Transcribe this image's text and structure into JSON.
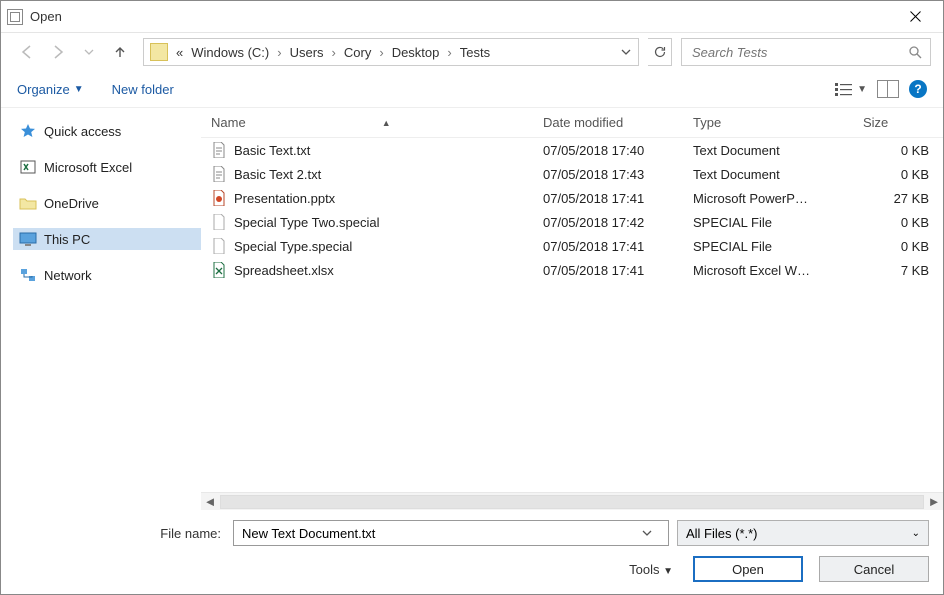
{
  "window": {
    "title": "Open"
  },
  "nav": {
    "breadcrumb_root": "«",
    "segments": [
      "Windows (C:)",
      "Users",
      "Cory",
      "Desktop",
      "Tests"
    ],
    "search_placeholder": "Search Tests"
  },
  "toolbar": {
    "organize": "Organize",
    "new_folder": "New folder"
  },
  "sidebar": {
    "items": [
      {
        "label": "Quick access",
        "icon": "star"
      },
      {
        "label": "Microsoft Excel",
        "icon": "excel"
      },
      {
        "label": "OneDrive",
        "icon": "folder"
      },
      {
        "label": "This PC",
        "icon": "pc",
        "selected": true
      },
      {
        "label": "Network",
        "icon": "network"
      }
    ]
  },
  "columns": {
    "name": "Name",
    "date": "Date modified",
    "type": "Type",
    "size": "Size"
  },
  "files": [
    {
      "name": "Basic Text.txt",
      "date": "07/05/2018 17:40",
      "type": "Text Document",
      "size": "0 KB",
      "icon": "txt"
    },
    {
      "name": "Basic Text 2.txt",
      "date": "07/05/2018 17:43",
      "type": "Text Document",
      "size": "0 KB",
      "icon": "txt"
    },
    {
      "name": "Presentation.pptx",
      "date": "07/05/2018 17:41",
      "type": "Microsoft PowerP…",
      "size": "27 KB",
      "icon": "pptx"
    },
    {
      "name": "Special Type Two.special",
      "date": "07/05/2018 17:42",
      "type": "SPECIAL File",
      "size": "0 KB",
      "icon": "blank"
    },
    {
      "name": "Special Type.special",
      "date": "07/05/2018 17:41",
      "type": "SPECIAL File",
      "size": "0 KB",
      "icon": "blank"
    },
    {
      "name": "Spreadsheet.xlsx",
      "date": "07/05/2018 17:41",
      "type": "Microsoft Excel W…",
      "size": "7 KB",
      "icon": "xlsx"
    }
  ],
  "bottom": {
    "filename_label": "File name:",
    "filename_value": "New Text Document.txt",
    "filter_label": "All Files (*.*)",
    "tools_label": "Tools",
    "open_label": "Open",
    "cancel_label": "Cancel"
  }
}
